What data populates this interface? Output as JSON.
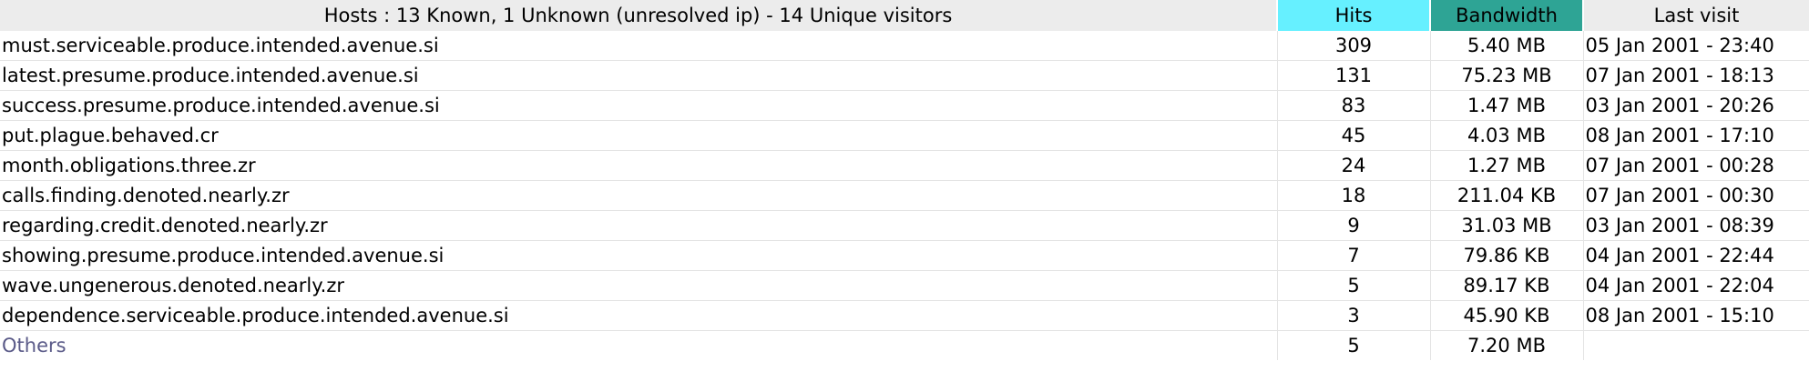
{
  "header": {
    "host_title": "Hosts : 13 Known, 1 Unknown (unresolved ip) - 14 Unique visitors",
    "hits": "Hits",
    "bandwidth": "Bandwidth",
    "last_visit": "Last visit"
  },
  "colors": {
    "hits_header": "#66f0ff",
    "bandwidth_header": "#2ea495",
    "plain_header": "#ececec",
    "others_text": "#5a5a88"
  },
  "rows": [
    {
      "host": "must.serviceable.produce.intended.avenue.si",
      "hits": "309",
      "bandwidth": "5.40 MB",
      "last_visit": "05 Jan 2001 - 23:40"
    },
    {
      "host": "latest.presume.produce.intended.avenue.si",
      "hits": "131",
      "bandwidth": "75.23 MB",
      "last_visit": "07 Jan 2001 - 18:13"
    },
    {
      "host": "success.presume.produce.intended.avenue.si",
      "hits": "83",
      "bandwidth": "1.47 MB",
      "last_visit": "03 Jan 2001 - 20:26"
    },
    {
      "host": "put.plague.behaved.cr",
      "hits": "45",
      "bandwidth": "4.03 MB",
      "last_visit": "08 Jan 2001 - 17:10"
    },
    {
      "host": "month.obligations.three.zr",
      "hits": "24",
      "bandwidth": "1.27 MB",
      "last_visit": "07 Jan 2001 - 00:28"
    },
    {
      "host": "calls.finding.denoted.nearly.zr",
      "hits": "18",
      "bandwidth": "211.04 KB",
      "last_visit": "07 Jan 2001 - 00:30"
    },
    {
      "host": "regarding.credit.denoted.nearly.zr",
      "hits": "9",
      "bandwidth": "31.03 MB",
      "last_visit": "03 Jan 2001 - 08:39"
    },
    {
      "host": "showing.presume.produce.intended.avenue.si",
      "hits": "7",
      "bandwidth": "79.86 KB",
      "last_visit": "04 Jan 2001 - 22:44"
    },
    {
      "host": "wave.ungenerous.denoted.nearly.zr",
      "hits": "5",
      "bandwidth": "89.17 KB",
      "last_visit": "04 Jan 2001 - 22:04"
    },
    {
      "host": "dependence.serviceable.produce.intended.avenue.si",
      "hits": "3",
      "bandwidth": "45.90 KB",
      "last_visit": "08 Jan 2001 - 15:10"
    }
  ],
  "others": {
    "label": "Others",
    "hits": "5",
    "bandwidth": "7.20 MB",
    "last_visit": ""
  }
}
